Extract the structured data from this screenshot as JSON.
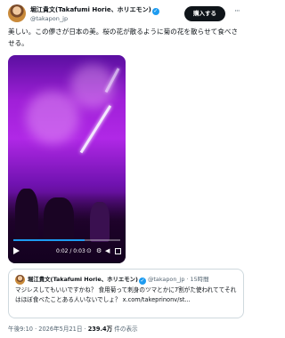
{
  "author": {
    "name": "堀江貴文(Takafumi Horie、ホリエモン)",
    "handle": "@takapon_jp",
    "verified_icon": "verified-check-icon"
  },
  "header": {
    "subscribe_label": "購入する",
    "more_label": "···"
  },
  "tweet": {
    "text": "美しい。この儚さが日本の美。桜の花が散るように菊の花を散らせて食べさせる。"
  },
  "video": {
    "time": "0:02 / 0:03",
    "progress_fraction": 0.67,
    "controls": [
      "play-icon",
      "captions-icon",
      "settings-icon",
      "volume-icon",
      "fullscreen-icon"
    ],
    "progress_color": "#1d9bf0"
  },
  "quote": {
    "name": "堀江貴文(Takafumi Horie、ホリエモン)",
    "handle": "@takapon_jp",
    "time": "15時間",
    "text": "マジレスしてもいいですかね？ 食用菊って刺身のツマとかに7割がた使われててそれはほぼ食べたことある人いないでしょ？ x.com/takeprinonv/st..."
  },
  "meta": {
    "time": "午後9:10 · 2026年5月21日 · ",
    "views_count": "239.4万",
    "views_label": " 件の表示"
  }
}
